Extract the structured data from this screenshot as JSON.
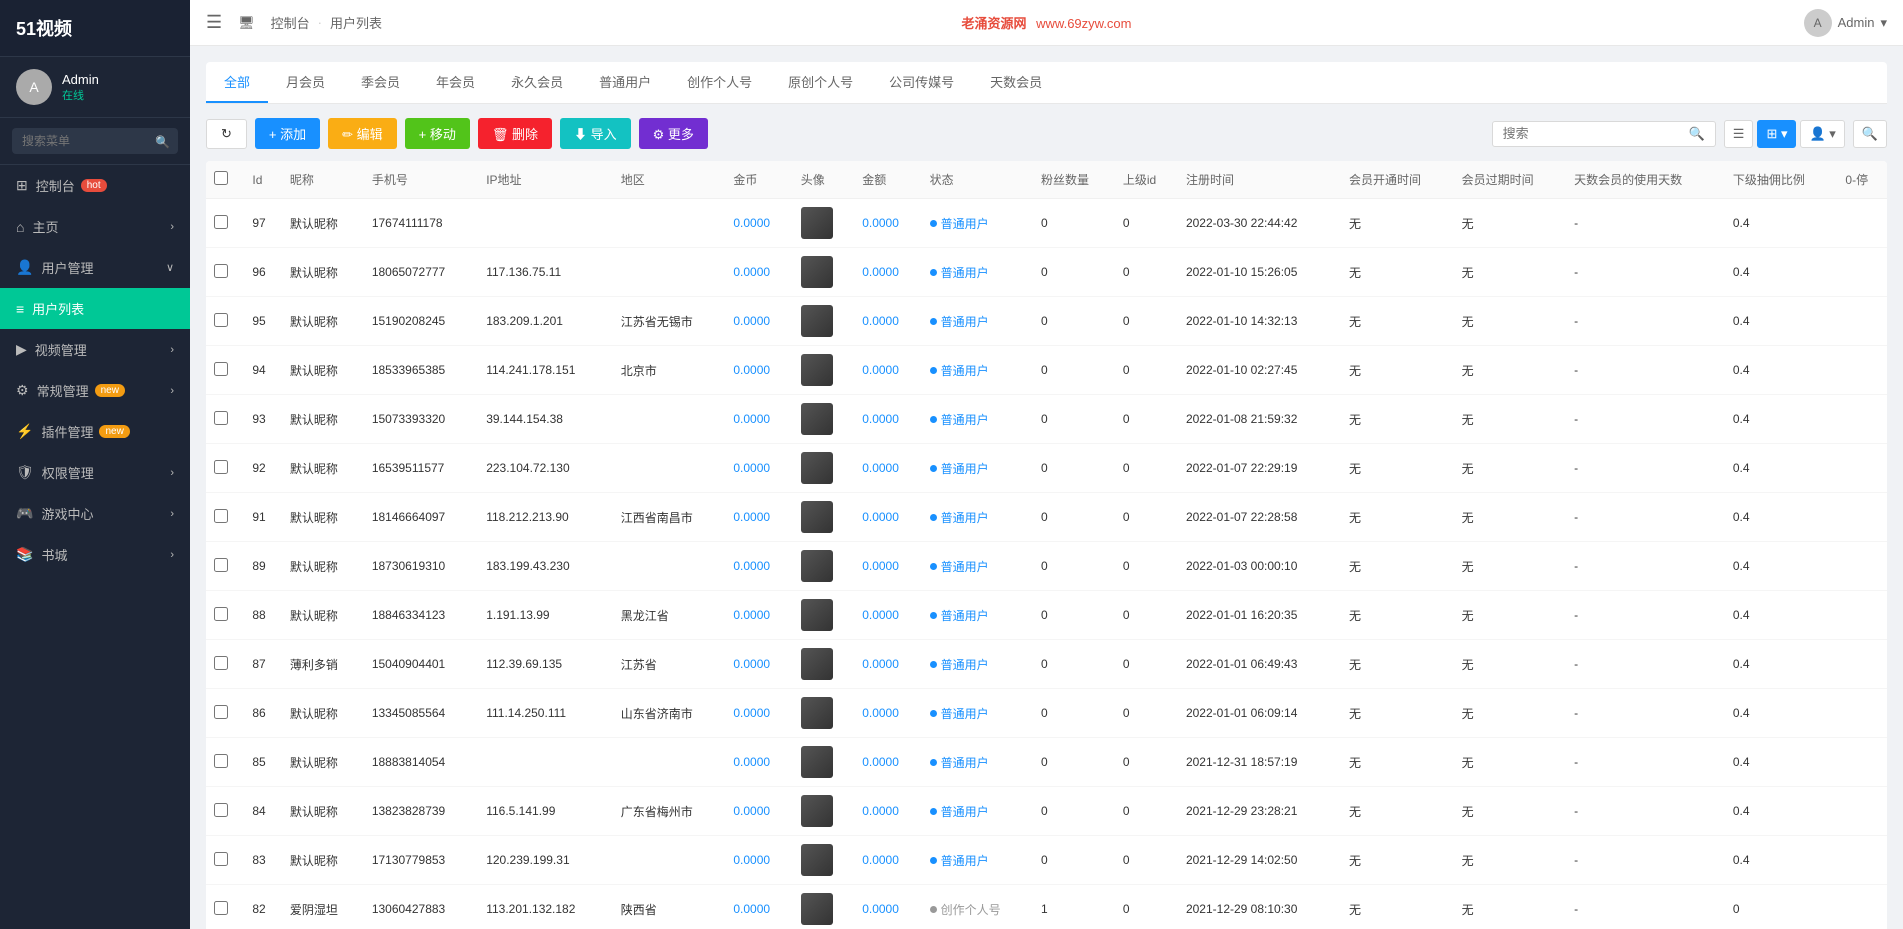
{
  "sidebar": {
    "logo": "51视频",
    "user": {
      "name": "Admin",
      "status": "在线"
    },
    "search_placeholder": "搜索菜单",
    "items": [
      {
        "id": "dashboard",
        "label": "控制台",
        "icon": "⊞",
        "badge": "hot",
        "has_arrow": false
      },
      {
        "id": "home",
        "label": "主页",
        "icon": "⌂",
        "badge": "",
        "has_arrow": true
      },
      {
        "id": "user-management",
        "label": "用户管理",
        "icon": "👤",
        "badge": "",
        "has_arrow": true
      },
      {
        "id": "user-list",
        "label": "用户列表",
        "icon": "≡",
        "badge": "",
        "has_arrow": false,
        "active": true
      },
      {
        "id": "video-management",
        "label": "视频管理",
        "icon": "▶",
        "badge": "",
        "has_arrow": true
      },
      {
        "id": "general-management",
        "label": "常规管理",
        "icon": "⚙",
        "badge": "new",
        "has_arrow": true
      },
      {
        "id": "plugin-management",
        "label": "插件管理",
        "icon": "🔌",
        "badge": "new",
        "has_arrow": false
      },
      {
        "id": "permission-management",
        "label": "权限管理",
        "icon": "🛡",
        "badge": "",
        "has_arrow": true
      },
      {
        "id": "game-center",
        "label": "游戏中心",
        "icon": "🎮",
        "badge": "",
        "has_arrow": true
      },
      {
        "id": "bookstore",
        "label": "书城",
        "icon": "📚",
        "badge": "",
        "has_arrow": true
      }
    ]
  },
  "topbar": {
    "breadcrumb": [
      "控制台",
      "用户列表"
    ],
    "watermark": "老涌资源网",
    "domain": "www.69zyw.com",
    "admin_label": "Admin"
  },
  "tabs": [
    {
      "id": "all",
      "label": "全部",
      "active": true
    },
    {
      "id": "monthly",
      "label": "月会员"
    },
    {
      "id": "quarterly",
      "label": "季会员"
    },
    {
      "id": "yearly",
      "label": "年会员"
    },
    {
      "id": "permanent",
      "label": "永久会员"
    },
    {
      "id": "normal",
      "label": "普通用户"
    },
    {
      "id": "creator-personal",
      "label": "创作个人号"
    },
    {
      "id": "original-personal",
      "label": "原创个人号"
    },
    {
      "id": "company",
      "label": "公司传媒号"
    },
    {
      "id": "tianmao",
      "label": "天数会员"
    }
  ],
  "toolbar": {
    "refresh_label": "↻",
    "add_label": "+ 添加",
    "edit_label": "✏ 编辑",
    "move_label": "+ 移动",
    "delete_label": "🗑 删除",
    "import_label": "⬇ 导入",
    "more_label": "⚙ 更多",
    "search_placeholder": "搜索"
  },
  "columns": [
    "Id",
    "昵称",
    "手机号",
    "IP地址",
    "地区",
    "金币",
    "头像",
    "金额",
    "状态",
    "粉丝数量",
    "上级id",
    "注册时间",
    "会员开通时间",
    "会员过期时间",
    "天数会员的使用天数",
    "下级抽佣比例",
    "0-停"
  ],
  "rows": [
    {
      "id": 97,
      "nickname": "默认昵称",
      "phone": "17674111178",
      "ip": "",
      "region": "",
      "coins": "0.0000",
      "amount": "0.0000",
      "status": "普通用户",
      "status_type": "normal",
      "fans": 0,
      "parent_id": 0,
      "reg_time": "2022-03-30 22:44:42",
      "member_start": "无",
      "member_end": "无",
      "tianmao_days": "-",
      "rebate": "0.4",
      "stopped": ""
    },
    {
      "id": 96,
      "nickname": "默认昵称",
      "phone": "18065072777",
      "ip": "117.136.75.11",
      "region": "",
      "coins": "0.0000",
      "amount": "0.0000",
      "status": "普通用户",
      "status_type": "normal",
      "fans": 0,
      "parent_id": 0,
      "reg_time": "2022-01-10 15:26:05",
      "member_start": "无",
      "member_end": "无",
      "tianmao_days": "-",
      "rebate": "0.4",
      "stopped": ""
    },
    {
      "id": 95,
      "nickname": "默认昵称",
      "phone": "15190208245",
      "ip": "183.209.1.201",
      "region": "江苏省无锡市",
      "coins": "0.0000",
      "amount": "0.0000",
      "status": "普通用户",
      "status_type": "normal",
      "fans": 0,
      "parent_id": 0,
      "reg_time": "2022-01-10 14:32:13",
      "member_start": "无",
      "member_end": "无",
      "tianmao_days": "-",
      "rebate": "0.4",
      "stopped": ""
    },
    {
      "id": 94,
      "nickname": "默认昵称",
      "phone": "18533965385",
      "ip": "114.241.178.151",
      "region": "北京市",
      "coins": "0.0000",
      "amount": "0.0000",
      "status": "普通用户",
      "status_type": "normal",
      "fans": 0,
      "parent_id": 0,
      "reg_time": "2022-01-10 02:27:45",
      "member_start": "无",
      "member_end": "无",
      "tianmao_days": "-",
      "rebate": "0.4",
      "stopped": ""
    },
    {
      "id": 93,
      "nickname": "默认昵称",
      "phone": "15073393320",
      "ip": "39.144.154.38",
      "region": "",
      "coins": "0.0000",
      "amount": "0.0000",
      "status": "普通用户",
      "status_type": "normal",
      "fans": 0,
      "parent_id": 0,
      "reg_time": "2022-01-08 21:59:32",
      "member_start": "无",
      "member_end": "无",
      "tianmao_days": "-",
      "rebate": "0.4",
      "stopped": ""
    },
    {
      "id": 92,
      "nickname": "默认昵称",
      "phone": "16539511577",
      "ip": "223.104.72.130",
      "region": "",
      "coins": "0.0000",
      "amount": "0.0000",
      "status": "普通用户",
      "status_type": "normal",
      "fans": 0,
      "parent_id": 0,
      "reg_time": "2022-01-07 22:29:19",
      "member_start": "无",
      "member_end": "无",
      "tianmao_days": "-",
      "rebate": "0.4",
      "stopped": ""
    },
    {
      "id": 91,
      "nickname": "默认昵称",
      "phone": "18146664097",
      "ip": "118.212.213.90",
      "region": "江西省南昌市",
      "coins": "0.0000",
      "amount": "0.0000",
      "status": "普通用户",
      "status_type": "normal",
      "fans": 0,
      "parent_id": 0,
      "reg_time": "2022-01-07 22:28:58",
      "member_start": "无",
      "member_end": "无",
      "tianmao_days": "-",
      "rebate": "0.4",
      "stopped": ""
    },
    {
      "id": 89,
      "nickname": "默认昵称",
      "phone": "18730619310",
      "ip": "183.199.43.230",
      "region": "",
      "coins": "0.0000",
      "amount": "0.0000",
      "status": "普通用户",
      "status_type": "normal",
      "fans": 0,
      "parent_id": 0,
      "reg_time": "2022-01-03 00:00:10",
      "member_start": "无",
      "member_end": "无",
      "tianmao_days": "-",
      "rebate": "0.4",
      "stopped": ""
    },
    {
      "id": 88,
      "nickname": "默认昵称",
      "phone": "18846334123",
      "ip": "1.191.13.99",
      "region": "黑龙江省",
      "coins": "0.0000",
      "amount": "0.0000",
      "status": "普通用户",
      "status_type": "normal",
      "fans": 0,
      "parent_id": 0,
      "reg_time": "2022-01-01 16:20:35",
      "member_start": "无",
      "member_end": "无",
      "tianmao_days": "-",
      "rebate": "0.4",
      "stopped": ""
    },
    {
      "id": 87,
      "nickname": "薄利多销",
      "phone": "15040904401",
      "ip": "112.39.69.135",
      "region": "江苏省",
      "coins": "0.0000",
      "amount": "0.0000",
      "status": "普通用户",
      "status_type": "normal",
      "fans": 0,
      "parent_id": 0,
      "reg_time": "2022-01-01 06:49:43",
      "member_start": "无",
      "member_end": "无",
      "tianmao_days": "-",
      "rebate": "0.4",
      "stopped": ""
    },
    {
      "id": 86,
      "nickname": "默认昵称",
      "phone": "13345085564",
      "ip": "111.14.250.111",
      "region": "山东省济南市",
      "coins": "0.0000",
      "amount": "0.0000",
      "status": "普通用户",
      "status_type": "normal",
      "fans": 0,
      "parent_id": 0,
      "reg_time": "2022-01-01 06:09:14",
      "member_start": "无",
      "member_end": "无",
      "tianmao_days": "-",
      "rebate": "0.4",
      "stopped": ""
    },
    {
      "id": 85,
      "nickname": "默认昵称",
      "phone": "18883814054",
      "ip": "",
      "region": "",
      "coins": "0.0000",
      "amount": "0.0000",
      "status": "普通用户",
      "status_type": "normal",
      "fans": 0,
      "parent_id": 0,
      "reg_time": "2021-12-31 18:57:19",
      "member_start": "无",
      "member_end": "无",
      "tianmao_days": "-",
      "rebate": "0.4",
      "stopped": ""
    },
    {
      "id": 84,
      "nickname": "默认昵称",
      "phone": "13823828739",
      "ip": "116.5.141.99",
      "region": "广东省梅州市",
      "coins": "0.0000",
      "amount": "0.0000",
      "status": "普通用户",
      "status_type": "normal",
      "fans": 0,
      "parent_id": 0,
      "reg_time": "2021-12-29 23:28:21",
      "member_start": "无",
      "member_end": "无",
      "tianmao_days": "-",
      "rebate": "0.4",
      "stopped": ""
    },
    {
      "id": 83,
      "nickname": "默认昵称",
      "phone": "17130779853",
      "ip": "120.239.199.31",
      "region": "",
      "coins": "0.0000",
      "amount": "0.0000",
      "status": "普通用户",
      "status_type": "normal",
      "fans": 0,
      "parent_id": 0,
      "reg_time": "2021-12-29 14:02:50",
      "member_start": "无",
      "member_end": "无",
      "tianmao_days": "-",
      "rebate": "0.4",
      "stopped": ""
    },
    {
      "id": 82,
      "nickname": "爱阴湿坦",
      "phone": "13060427883",
      "ip": "113.201.132.182",
      "region": "陕西省",
      "coins": "0.0000",
      "amount": "0.0000",
      "status": "创作个人号",
      "status_type": "creator",
      "fans": 1,
      "parent_id": 0,
      "reg_time": "2021-12-29 08:10:30",
      "member_start": "无",
      "member_end": "无",
      "tianmao_days": "-",
      "rebate": "0",
      "stopped": ""
    }
  ]
}
